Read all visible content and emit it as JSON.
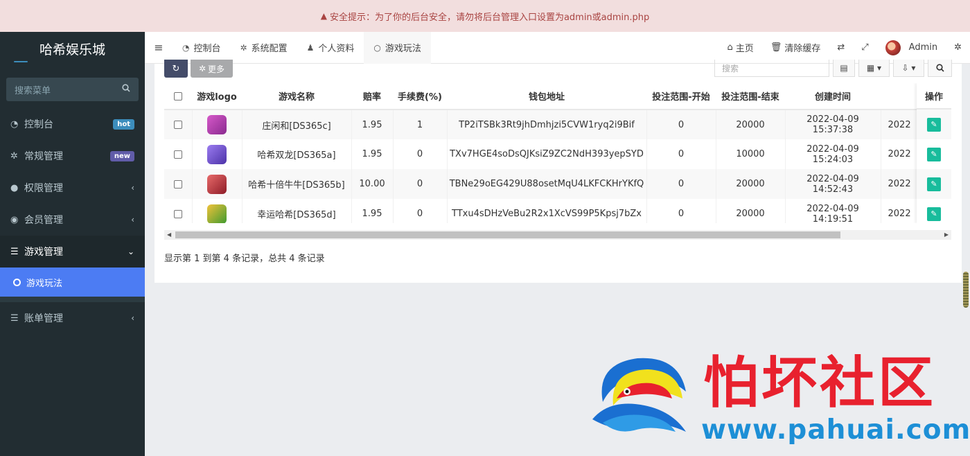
{
  "security_notice": "安全提示：为了你的后台安全，请勿将后台管理入口设置为admin或admin.php",
  "sidebar": {
    "brand": "哈希娱乐城",
    "search_placeholder": "搜索菜单",
    "items": [
      {
        "icon": "dashboard-icon",
        "label": "控制台",
        "badge": "hot"
      },
      {
        "icon": "cogs-icon",
        "label": "常规管理",
        "badge": "new"
      },
      {
        "icon": "users-icon",
        "label": "权限管理"
      },
      {
        "icon": "user-circle-icon",
        "label": "会员管理"
      },
      {
        "icon": "list-icon",
        "label": "游戏管理"
      },
      {
        "icon": "list-icon",
        "label": "账单管理"
      }
    ],
    "sub_item": "游戏玩法"
  },
  "topnav": {
    "tabs": [
      {
        "icon": "dashboard-icon",
        "label": "控制台"
      },
      {
        "icon": "gear-icon",
        "label": "系统配置"
      },
      {
        "icon": "user-icon",
        "label": "个人资料"
      },
      {
        "icon": "circle-icon",
        "label": "游戏玩法"
      }
    ],
    "home": "主页",
    "clear_cache": "清除缓存",
    "user": "Admin"
  },
  "toolbar": {
    "more": "更多",
    "search_placeholder": "搜索"
  },
  "table": {
    "columns": [
      "游戏logo",
      "游戏名称",
      "赔率",
      "手续费(%)",
      "钱包地址",
      "投注范围-开始",
      "投注范围-结束",
      "创建时间",
      "操作"
    ],
    "rows": [
      {
        "name": "庄闲和[DS365c]",
        "odds": "1.95",
        "fee": "1",
        "wallet": "TP2iTSBk3Rt9jhDmhjzi5CVW1ryq2i9Bif",
        "min": "0",
        "max": "20000",
        "created": "2022-04-09 15:37:38",
        "next": "2022",
        "logo_color": "#b53fb0"
      },
      {
        "name": "哈希双龙[DS365a]",
        "odds": "1.95",
        "fee": "0",
        "wallet": "TXv7HGE4soDsQJKsiZ9ZC2NdH393yepSYD",
        "min": "0",
        "max": "10000",
        "created": "2022-04-09 15:24:03",
        "next": "2022",
        "logo_color": "#6e4fc9"
      },
      {
        "name": "哈希十倍牛牛[DS365b]",
        "odds": "10.00",
        "fee": "0",
        "wallet": "TBNe29oEG429U88osetMqU4LKFCKHrYKfQ",
        "min": "0",
        "max": "20000",
        "created": "2022-04-09 14:52:43",
        "next": "2022",
        "logo_color": "#c2343c"
      },
      {
        "name": "幸运哈希[DS365d]",
        "odds": "1.95",
        "fee": "0",
        "wallet": "TTxu4sDHzVeBu2R2x1XcVS99P5Kpsj7bZx",
        "min": "0",
        "max": "20000",
        "created": "2022-04-09 14:19:51",
        "next": "2022",
        "logo_color": "#5aa12f"
      }
    ]
  },
  "pager_info": "显示第 1 到第 4 条记录，总共 4 条记录",
  "watermark": {
    "title": "怕坏社区",
    "url": "www.pahuai.com"
  }
}
